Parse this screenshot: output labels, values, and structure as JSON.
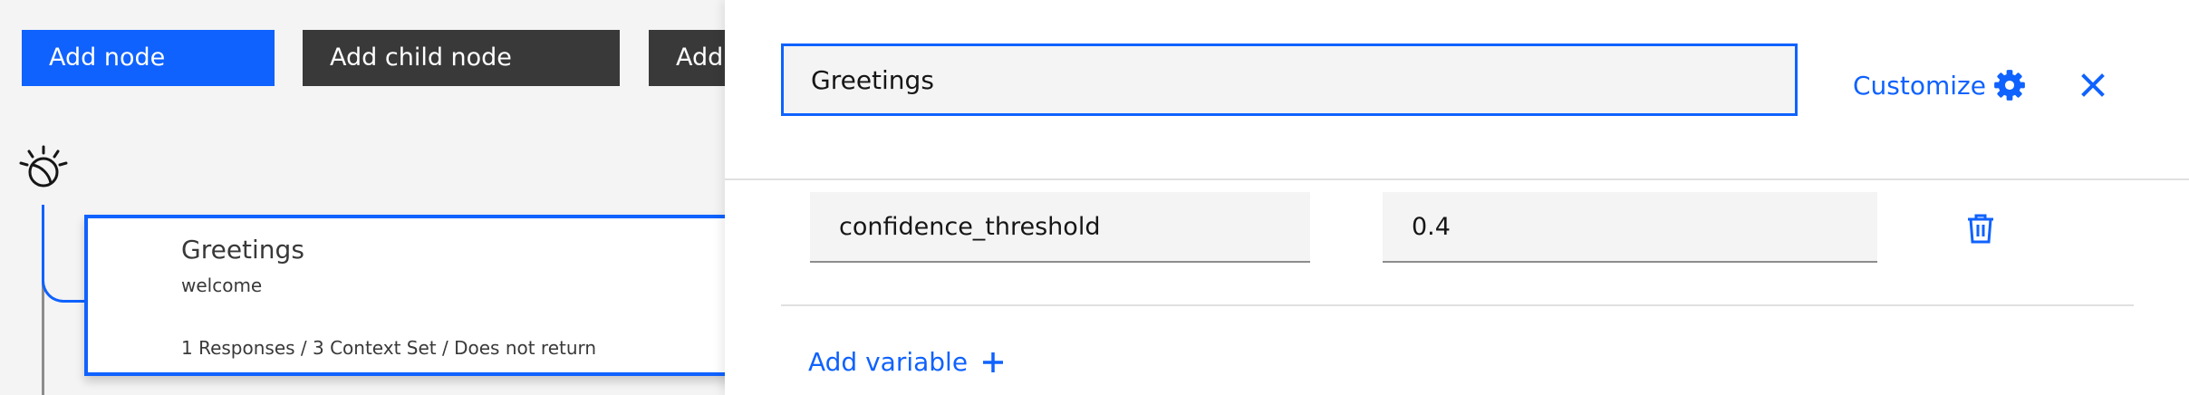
{
  "toolbar": {
    "add_node_label": "Add node",
    "add_child_node_label": "Add child node",
    "add_folder_label": "Add folder"
  },
  "node": {
    "title": "Greetings",
    "condition": "welcome",
    "meta": "1 Responses / 3 Context Set / Does not return"
  },
  "panel": {
    "node_name_value": "Greetings",
    "customize_label": "Customize",
    "variable": {
      "name": "confidence_threshold",
      "value": "0.4"
    },
    "add_variable_label": "Add variable"
  },
  "colors": {
    "accent": "#0f62fe",
    "dark_button": "#393939",
    "field_bg": "#f4f4f4"
  },
  "icons": [
    "watson-icon",
    "gear-icon",
    "close-icon",
    "trash-icon",
    "plus-icon"
  ]
}
